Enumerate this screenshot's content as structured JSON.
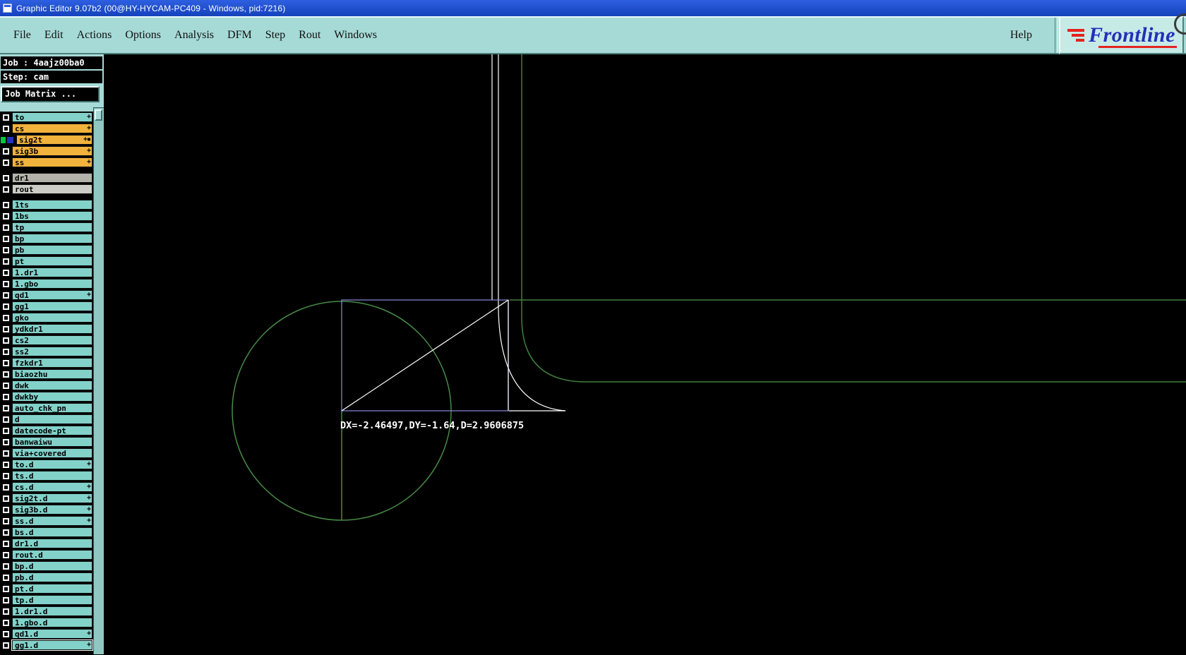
{
  "window": {
    "title": "Graphic Editor 9.07b2 (00@HY-HYCAM-PC409 - Windows, pid:7216)"
  },
  "menu": {
    "items": [
      "File",
      "Edit",
      "Actions",
      "Options",
      "Analysis",
      "DFM",
      "Step",
      "Rout",
      "Windows"
    ],
    "help_label": "Help",
    "brand": "Frontline"
  },
  "job_panel": {
    "job_label": "Job : 4aajz00ba0",
    "step_label": "Step: cam",
    "matrix_button_label": "Job Matrix ..."
  },
  "layers": {
    "groups": [
      {
        "rows": [
          {
            "name": "to",
            "color": "teal",
            "marks": "+",
            "checked": true
          },
          {
            "name": "cs",
            "color": "orange",
            "marks": "+",
            "checked": true
          },
          {
            "name": "sig2t",
            "color": "orange",
            "marks": "+▪",
            "checked": true,
            "active": true
          },
          {
            "name": "sig3b",
            "color": "orange",
            "marks": "+",
            "checked": true
          },
          {
            "name": "ss",
            "color": "orange",
            "marks": "+",
            "checked": true
          }
        ]
      },
      {
        "rows": [
          {
            "name": "dr1",
            "color": "gray",
            "checked": true
          },
          {
            "name": "rout",
            "color": "gray-light",
            "checked": true
          }
        ]
      },
      {
        "rows": [
          {
            "name": "1ts",
            "color": "teal",
            "checked": true
          },
          {
            "name": "1bs",
            "color": "teal",
            "checked": true
          },
          {
            "name": "tp",
            "color": "teal",
            "checked": true
          },
          {
            "name": "bp",
            "color": "teal",
            "checked": true
          },
          {
            "name": "pb",
            "color": "teal",
            "checked": true
          },
          {
            "name": "pt",
            "color": "teal",
            "checked": true
          },
          {
            "name": "1.dr1",
            "color": "teal",
            "checked": true
          },
          {
            "name": "1.gbo",
            "color": "teal",
            "checked": true
          },
          {
            "name": "qd1",
            "color": "teal",
            "marks": "+",
            "checked": true
          },
          {
            "name": "gg1",
            "color": "teal",
            "checked": true
          },
          {
            "name": "gko",
            "color": "teal",
            "checked": true
          },
          {
            "name": "ydkdr1",
            "color": "teal",
            "checked": true
          },
          {
            "name": "cs2",
            "color": "teal",
            "checked": true
          },
          {
            "name": "ss2",
            "color": "teal",
            "checked": true
          },
          {
            "name": "fzkdr1",
            "color": "teal",
            "checked": true
          },
          {
            "name": "biaozhu",
            "color": "teal",
            "checked": true
          },
          {
            "name": "dwk",
            "color": "teal",
            "checked": true
          },
          {
            "name": "dwkby",
            "color": "teal",
            "checked": true
          },
          {
            "name": "auto_chk_pn",
            "color": "teal",
            "checked": true
          },
          {
            "name": "d",
            "color": "teal",
            "checked": true
          },
          {
            "name": "datecode-pt",
            "color": "teal",
            "checked": true
          },
          {
            "name": "banwaiwu",
            "color": "teal",
            "checked": true
          },
          {
            "name": "via+covered",
            "color": "teal",
            "checked": true
          },
          {
            "name": "to.d",
            "color": "teal",
            "marks": "+",
            "checked": true
          },
          {
            "name": "ts.d",
            "color": "teal",
            "checked": true
          },
          {
            "name": "cs.d",
            "color": "teal",
            "marks": "+",
            "checked": true
          },
          {
            "name": "sig2t.d",
            "color": "teal",
            "marks": "+",
            "checked": true
          },
          {
            "name": "sig3b.d",
            "color": "teal",
            "marks": "+",
            "checked": true
          },
          {
            "name": "ss.d",
            "color": "teal",
            "marks": "+",
            "checked": true
          },
          {
            "name": "bs.d",
            "color": "teal",
            "checked": true
          },
          {
            "name": "dr1.d",
            "color": "teal",
            "checked": true
          },
          {
            "name": "rout.d",
            "color": "teal",
            "checked": true
          },
          {
            "name": "bp.d",
            "color": "teal",
            "checked": true
          },
          {
            "name": "pb.d",
            "color": "teal",
            "checked": true
          },
          {
            "name": "pt.d",
            "color": "teal",
            "checked": true
          },
          {
            "name": "tp.d",
            "color": "teal",
            "checked": true
          },
          {
            "name": "1.dr1.d",
            "color": "teal",
            "checked": true
          },
          {
            "name": "1.gbo.d",
            "color": "teal",
            "checked": true
          },
          {
            "name": "qd1.d",
            "color": "teal",
            "marks": "+",
            "checked": true
          },
          {
            "name": "gg1.d",
            "color": "teal",
            "marks": "+",
            "checked": true,
            "selected": true
          }
        ]
      }
    ]
  },
  "canvas": {
    "measurement_text": "DX=-2.46497,DY=-1.64,D=2.9606875"
  },
  "colors": {
    "menu_teal": "#a6dad6",
    "layer_teal": "#82d2ca",
    "layer_orange": "#f2b33c",
    "layer_gray": "#b3b3ab",
    "trace_green": "#478a47",
    "measure_purple": "#8d8ade",
    "highlight_white": "#ffffff",
    "titlebar_blue": "#1d4fd0",
    "brand_blue": "#2430b8",
    "brand_red": "#e3241f",
    "active_green": "#00c840",
    "active_blue": "#2233bb"
  }
}
